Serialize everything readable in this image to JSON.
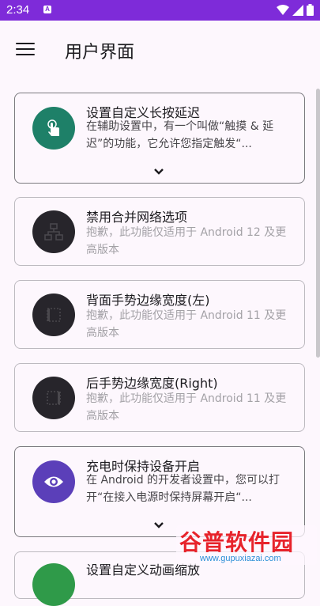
{
  "status_bar": {
    "time": "2:34",
    "notification_glyph": "A",
    "icons": [
      "wifi-icon",
      "signal-icon",
      "battery-icon"
    ]
  },
  "app_bar": {
    "title": "用户界面",
    "menu_icon": "menu-icon"
  },
  "cards": [
    {
      "title": "设置自定义长按延迟",
      "desc": "在辅助设置中，有一个叫做“触摸 & 延迟”的功能，它允许您指定触发“...",
      "icon": "touch-icon",
      "color": "#1e8068",
      "state": "enabled",
      "expandable": true
    },
    {
      "title": "禁用合并网络选项",
      "desc": "抱歉，此功能仅适用于 Android 12 及更高版本",
      "icon": "network-icon",
      "color": "#27252b",
      "state": "disabled"
    },
    {
      "title": "背面手势边缘宽度(左)",
      "desc": "抱歉，此功能仅适用于 Android 11 及更高版本",
      "icon": "edge-left-icon",
      "color": "#27252b",
      "state": "disabled"
    },
    {
      "title": "后手势边缘宽度(Right)",
      "desc": "抱歉，此功能仅适用于 Android 11 及更高版本",
      "icon": "edge-right-icon",
      "color": "#27252b",
      "state": "disabled"
    },
    {
      "title": "充电时保持设备开启",
      "desc": "在 Android 的开发者设置中，您可以打开“在接入电源时保持屏幕开启“...",
      "icon": "eye-icon",
      "color": "#5b3fb9",
      "state": "enabled",
      "expandable": true
    },
    {
      "title": "设置自定义动画缩放",
      "icon": "animation-icon",
      "color": "#2f9a49",
      "state": "partial"
    }
  ],
  "watermark": {
    "main": "谷普软件园",
    "url": "www.gupuxiazai.com"
  }
}
